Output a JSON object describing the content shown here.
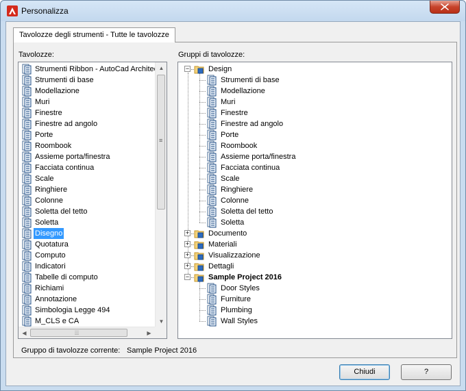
{
  "window": {
    "title": "Personalizza",
    "close_label": "✕"
  },
  "tab": {
    "label": "Tavolozze degli strumenti - Tutte le tavolozze"
  },
  "palettes": {
    "label": "Tavolozze:",
    "selected_index": 15,
    "items": [
      "Strumenti Ribbon - AutoCad Architecture",
      "Strumenti di base",
      "Modellazione",
      "Muri",
      "Finestre",
      "Finestre ad angolo",
      "Porte",
      "Roombook",
      "Assieme porta/finestra",
      "Facciata continua",
      "Scale",
      "Ringhiere",
      "Colonne",
      "Soletta del tetto",
      "Soletta",
      "Disegno",
      "Quotatura",
      "Computo",
      "Indicatori",
      "Tabelle di computo",
      "Richiami",
      "Annotazione",
      "Simbologia Legge 494",
      "M_CLS e CA"
    ]
  },
  "groups": {
    "label": "Gruppi di tavolozze:",
    "tree": [
      {
        "label": "Design",
        "expanded": true,
        "children": [
          "Strumenti di base",
          "Modellazione",
          "Muri",
          "Finestre",
          "Finestre ad angolo",
          "Porte",
          "Roombook",
          "Assieme porta/finestra",
          "Facciata continua",
          "Scale",
          "Ringhiere",
          "Colonne",
          "Soletta del tetto",
          "Soletta"
        ]
      },
      {
        "label": "Documento",
        "expanded": false,
        "children": []
      },
      {
        "label": "Materiali",
        "expanded": false,
        "children": []
      },
      {
        "label": "Visualizzazione",
        "expanded": false,
        "children": []
      },
      {
        "label": "Dettagli",
        "expanded": false,
        "children": []
      },
      {
        "label": "Sample Project 2016",
        "expanded": true,
        "bold": true,
        "children": [
          "Door Styles",
          "Furniture",
          "Plumbing",
          "Wall Styles"
        ]
      }
    ]
  },
  "current_group": {
    "label": "Gruppo di tavolozze corrente:",
    "value": "Sample Project 2016"
  },
  "buttons": {
    "close": "Chiudi",
    "help": "?"
  },
  "colors": {
    "selection": "#3399ff",
    "titlebar": "#c9dcef",
    "close": "#c7432b"
  }
}
